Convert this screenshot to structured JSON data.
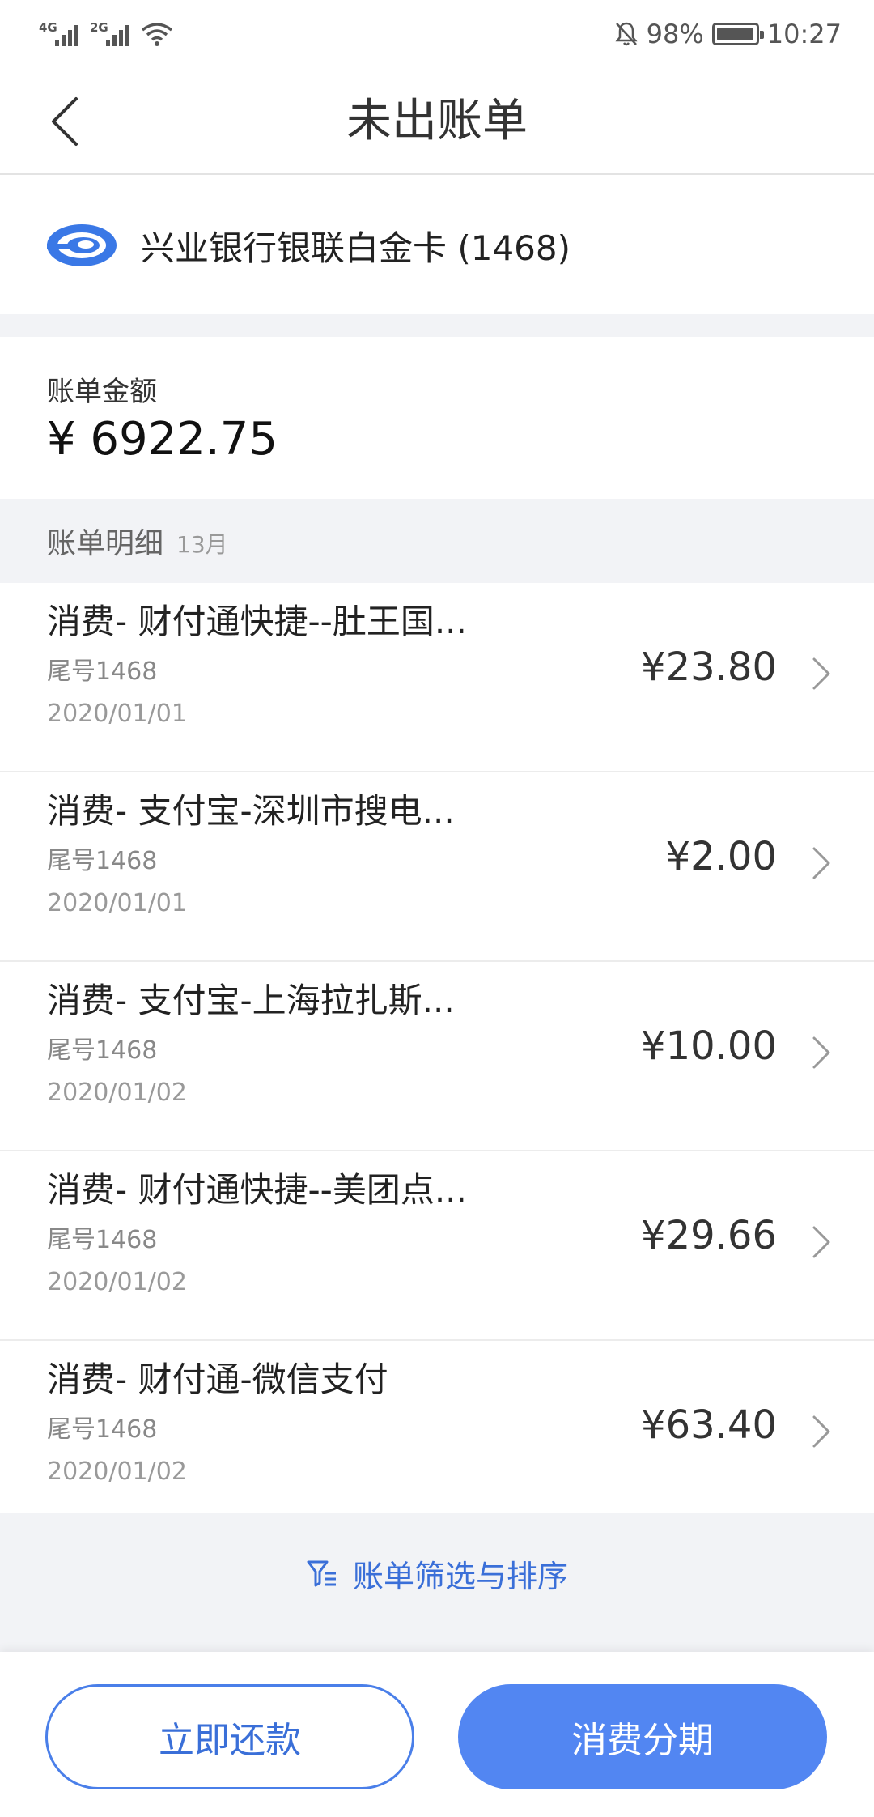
{
  "status_bar": {
    "net1": "4G",
    "net2": "2G",
    "battery": "98%",
    "battery_level": 0.98,
    "time": "10:27"
  },
  "header": {
    "title": "未出账单"
  },
  "card": {
    "name": "兴业银行银联白金卡 (1468)",
    "logo_color": "#3a78e6"
  },
  "bill": {
    "label": "账单金额",
    "amount": "¥ 6922.75"
  },
  "details": {
    "title": "账单明细",
    "month": "13月"
  },
  "transactions": [
    {
      "title": "消费- 财付通快捷--肚王国...",
      "card": "尾号1468",
      "date": "2020/01/01",
      "amount": "¥23.80"
    },
    {
      "title": "消费- 支付宝-深圳市搜电...",
      "card": "尾号1468",
      "date": "2020/01/01",
      "amount": "¥2.00"
    },
    {
      "title": "消费- 支付宝-上海拉扎斯...",
      "card": "尾号1468",
      "date": "2020/01/02",
      "amount": "¥10.00"
    },
    {
      "title": "消费- 财付通快捷--美团点...",
      "card": "尾号1468",
      "date": "2020/01/02",
      "amount": "¥29.66"
    },
    {
      "title": "消费- 财付通-微信支付",
      "card": "尾号1468",
      "date": "2020/01/02",
      "amount": "¥63.40"
    }
  ],
  "filter": {
    "label": "账单筛选与排序"
  },
  "actions": {
    "repay": "立即还款",
    "installment": "消费分期"
  },
  "colors": {
    "accent": "#5286f2",
    "accent_text": "#3a6fd8"
  }
}
